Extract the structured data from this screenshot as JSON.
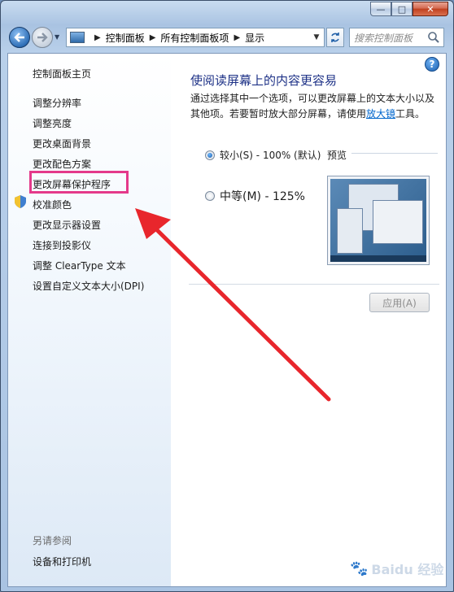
{
  "window": {
    "min_glyph": "—",
    "max_glyph": "□",
    "close_glyph": "✕"
  },
  "nav": {
    "breadcrumb": [
      "控制面板",
      "所有控制面板项",
      "显示"
    ],
    "search_placeholder": "搜索控制面板"
  },
  "sidebar": {
    "home": "控制面板主页",
    "items": [
      "调整分辨率",
      "调整亮度",
      "更改桌面背景",
      "更改配色方案",
      "更改屏幕保护程序",
      "校准颜色",
      "更改显示器设置",
      "连接到投影仪",
      "调整 ClearType 文本",
      "设置自定义文本大小(DPI)"
    ],
    "see_also": "另请参阅",
    "footer_link": "设备和打印机"
  },
  "main": {
    "heading": "使阅读屏幕上的内容更容易",
    "desc_part1": "通过选择其中一个选项，可以更改屏幕上的文本大小以及其他项。若要暂时放大部分屏幕，请使用",
    "desc_link": "放大镜",
    "desc_part2": "工具。",
    "options": [
      {
        "label": "较小(S) - 100% (默认)",
        "selected": true
      },
      {
        "label": "中等(M) - 125%",
        "selected": false
      }
    ],
    "preview_label": "预览",
    "apply_label": "应用(A)",
    "help_glyph": "?"
  },
  "watermark": "Baidu 经验",
  "colors": {
    "highlight": "#e4398a",
    "arrow": "#e8262c",
    "heading": "#1e3287",
    "link": "#0066cc"
  }
}
